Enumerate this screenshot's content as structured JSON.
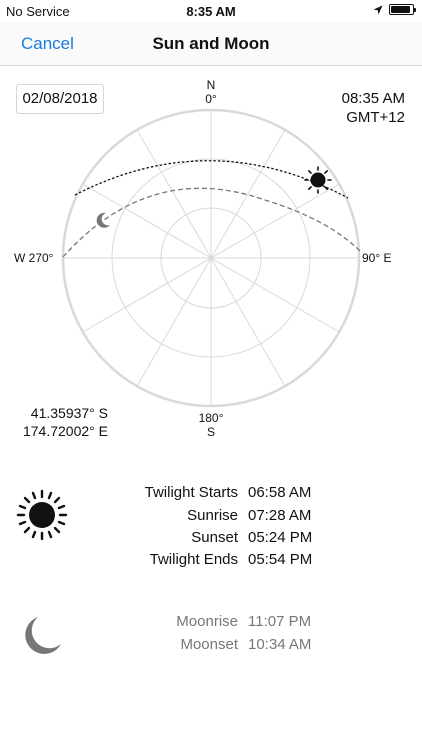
{
  "status_bar": {
    "carrier": "No Service",
    "time": "8:35 AM",
    "battery_level": 0.92
  },
  "nav": {
    "cancel_label": "Cancel",
    "title": "Sun and Moon"
  },
  "date": "02/08/2018",
  "time": "08:35 AM",
  "timezone": "GMT+12",
  "compass": {
    "north": "N",
    "north_deg": "0°",
    "east": "90° E",
    "west": "W 270°",
    "south_deg": "180°",
    "south": "S"
  },
  "location": {
    "latitude": "41.35937° S",
    "longitude": "174.72002° E"
  },
  "sun_events": [
    {
      "label": "Twilight Starts",
      "value": "06:58 AM"
    },
    {
      "label": "Sunrise",
      "value": "07:28 AM"
    },
    {
      "label": "Sunset",
      "value": "05:24 PM"
    },
    {
      "label": "Twilight Ends",
      "value": "05:54 PM"
    }
  ],
  "moon_events": [
    {
      "label": "Moonrise",
      "value": "11:07 PM"
    },
    {
      "label": "Moonset",
      "value": "10:34 AM"
    }
  ],
  "colors": {
    "accent": "#1a7be0",
    "grid": "#d9d9d9",
    "moon": "#777777"
  }
}
